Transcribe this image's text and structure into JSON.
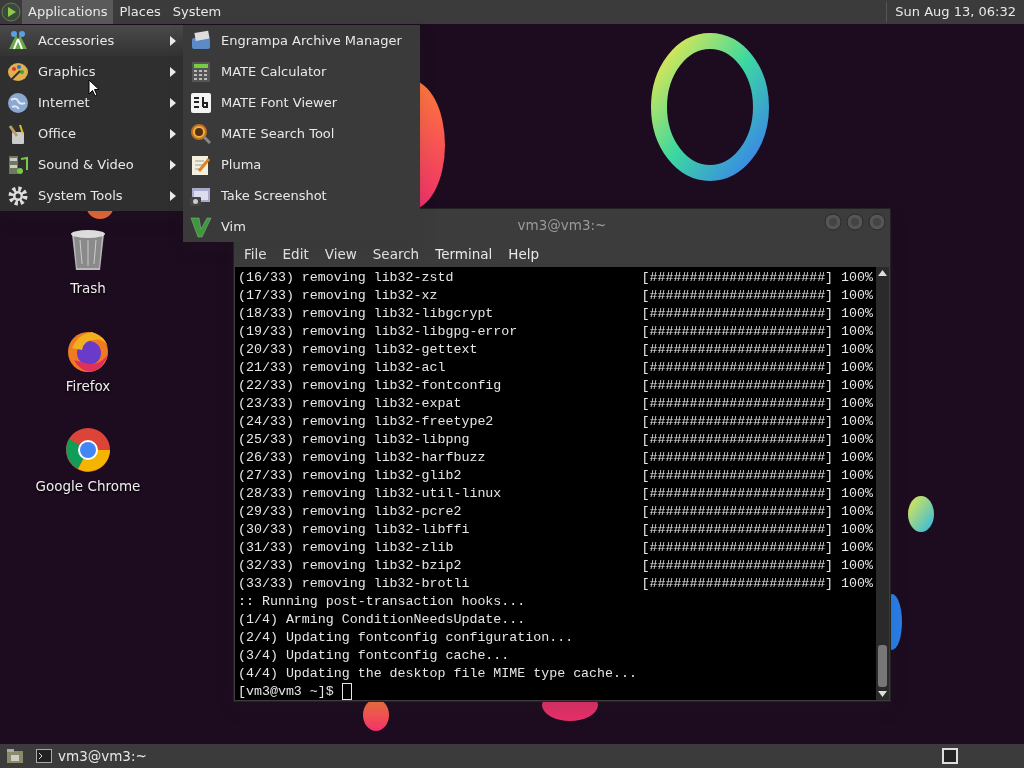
{
  "top_panel": {
    "menus": [
      {
        "label": "Applications",
        "selected": true
      },
      {
        "label": "Places",
        "selected": false
      },
      {
        "label": "System",
        "selected": false
      }
    ],
    "clock": "Sun Aug 13, 06:32"
  },
  "app_menu": {
    "items": [
      {
        "label": "Accessories",
        "selected": true
      },
      {
        "label": "Graphics",
        "selected": false
      },
      {
        "label": "Internet",
        "selected": false
      },
      {
        "label": "Office",
        "selected": false
      },
      {
        "label": "Sound & Video",
        "selected": false
      },
      {
        "label": "System Tools",
        "selected": false
      }
    ],
    "submenu": [
      "Engrampa Archive Manager",
      "MATE Calculator",
      "MATE Font Viewer",
      "MATE Search Tool",
      "Pluma",
      "Take Screenshot",
      "Vim"
    ]
  },
  "desktop_icons": [
    "Trash",
    "Firefox",
    "Google Chrome"
  ],
  "terminal": {
    "title": "vm3@vm3:~",
    "menus": [
      "File",
      "Edit",
      "View",
      "Search",
      "Terminal",
      "Help"
    ],
    "lines": [
      {
        "kind": "progress",
        "text": "(16/33) removing lib32-zstd",
        "bar": "[######################]",
        "percent": "100%"
      },
      {
        "kind": "progress",
        "text": "(17/33) removing lib32-xz",
        "bar": "[######################]",
        "percent": "100%"
      },
      {
        "kind": "progress",
        "text": "(18/33) removing lib32-libgcrypt",
        "bar": "[######################]",
        "percent": "100%"
      },
      {
        "kind": "progress",
        "text": "(19/33) removing lib32-libgpg-error",
        "bar": "[######################]",
        "percent": "100%"
      },
      {
        "kind": "progress",
        "text": "(20/33) removing lib32-gettext",
        "bar": "[######################]",
        "percent": "100%"
      },
      {
        "kind": "progress",
        "text": "(21/33) removing lib32-acl",
        "bar": "[######################]",
        "percent": "100%"
      },
      {
        "kind": "progress",
        "text": "(22/33) removing lib32-fontconfig",
        "bar": "[######################]",
        "percent": "100%"
      },
      {
        "kind": "progress",
        "text": "(23/33) removing lib32-expat",
        "bar": "[######################]",
        "percent": "100%"
      },
      {
        "kind": "progress",
        "text": "(24/33) removing lib32-freetype2",
        "bar": "[######################]",
        "percent": "100%"
      },
      {
        "kind": "progress",
        "text": "(25/33) removing lib32-libpng",
        "bar": "[######################]",
        "percent": "100%"
      },
      {
        "kind": "progress",
        "text": "(26/33) removing lib32-harfbuzz",
        "bar": "[######################]",
        "percent": "100%"
      },
      {
        "kind": "progress",
        "text": "(27/33) removing lib32-glib2",
        "bar": "[######################]",
        "percent": "100%"
      },
      {
        "kind": "progress",
        "text": "(28/33) removing lib32-util-linux",
        "bar": "[######################]",
        "percent": "100%"
      },
      {
        "kind": "progress",
        "text": "(29/33) removing lib32-pcre2",
        "bar": "[######################]",
        "percent": "100%"
      },
      {
        "kind": "progress",
        "text": "(30/33) removing lib32-libffi",
        "bar": "[######################]",
        "percent": "100%"
      },
      {
        "kind": "progress",
        "text": "(31/33) removing lib32-zlib",
        "bar": "[######################]",
        "percent": "100%"
      },
      {
        "kind": "progress",
        "text": "(32/33) removing lib32-bzip2",
        "bar": "[######################]",
        "percent": "100%"
      },
      {
        "kind": "progress",
        "text": "(33/33) removing lib32-brotli",
        "bar": "[######################]",
        "percent": "100%"
      },
      {
        "kind": "plain",
        "text": ":: Running post-transaction hooks..."
      },
      {
        "kind": "plain",
        "text": "(1/4) Arming ConditionNeedsUpdate..."
      },
      {
        "kind": "plain",
        "text": "(2/4) Updating fontconfig configuration..."
      },
      {
        "kind": "plain",
        "text": "(3/4) Updating fontconfig cache..."
      },
      {
        "kind": "plain",
        "text": "(4/4) Updating the desktop file MIME type cache..."
      },
      {
        "kind": "prompt",
        "text": "[vm3@vm3 ~]$"
      }
    ]
  },
  "taskbar": {
    "tasks": [
      "vm3@vm3:~"
    ]
  }
}
